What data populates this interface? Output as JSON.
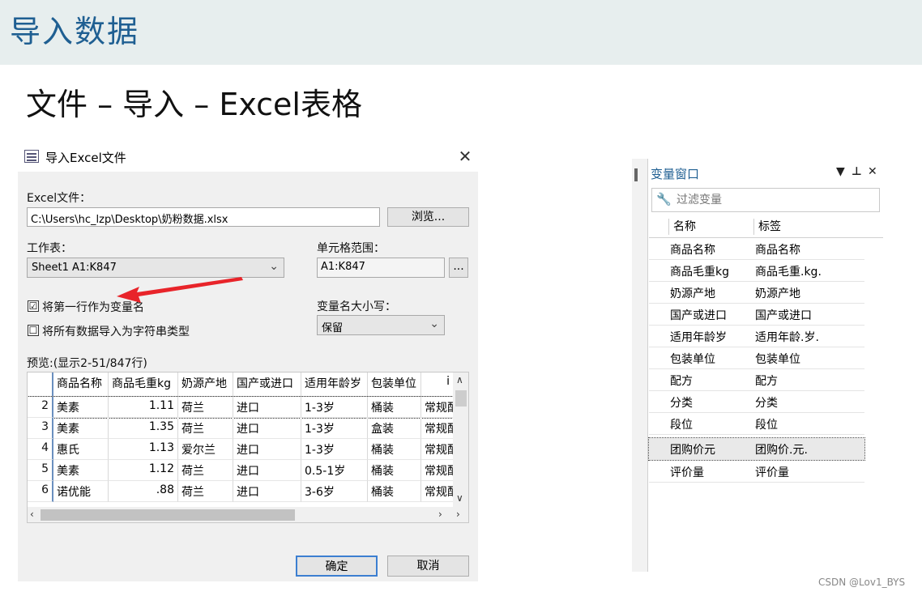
{
  "slide": {
    "title": "导入数据",
    "subtitle": "文件 – 导入 – Excel表格"
  },
  "dialog": {
    "title": "导入Excel文件",
    "file_label": "Excel文件：",
    "file_path": "C:\\Users\\hc_lzp\\Desktop\\奶粉数据.xlsx",
    "browse_button": "浏览...",
    "sheet_label": "工作表：",
    "sheet_value": "Sheet1 A1:K847",
    "range_label": "单元格范围：",
    "range_value": "A1:K847",
    "range_button": "...",
    "first_row_checkbox": {
      "label": "将第一行作为变量名",
      "checked": true,
      "mark": "☑"
    },
    "import_string_checkbox": {
      "label": "将所有数据导入为字符串类型",
      "checked": false,
      "mark": "☐"
    },
    "case_label": "变量名大小写：",
    "case_value": "保留",
    "preview_label": "预览:(显示2-51/847行)",
    "ok_button": "确定",
    "cancel_button": "取消",
    "close_glyph": "✕",
    "preview": {
      "columns": [
        "商品名称",
        "商品毛重kg",
        "奶源产地",
        "国产或进口",
        "适用年龄岁",
        "包装单位",
        "i"
      ],
      "rows": [
        {
          "n": "2",
          "cells": [
            "美素",
            "1.11",
            "荷兰",
            "进口",
            "1-3岁",
            "桶装",
            "常规配"
          ]
        },
        {
          "n": "3",
          "cells": [
            "美素",
            "1.35",
            "荷兰",
            "进口",
            "1-3岁",
            "盒装",
            "常规配"
          ]
        },
        {
          "n": "4",
          "cells": [
            "惠氏",
            "1.13",
            "爱尔兰",
            "进口",
            "1-3岁",
            "桶装",
            "常规配"
          ]
        },
        {
          "n": "5",
          "cells": [
            "美素",
            "1.12",
            "荷兰",
            "进口",
            "0.5-1岁",
            "桶装",
            "常规配"
          ]
        },
        {
          "n": "6",
          "cells": [
            "诺优能",
            ".88",
            "荷兰",
            "进口",
            "3-6岁",
            "桶装",
            "常规配"
          ]
        }
      ]
    }
  },
  "variable_window": {
    "title": "变量窗口",
    "controls": [
      "▼",
      "⊥",
      "✕"
    ],
    "filter_placeholder": "过滤变量",
    "filter_icon": "🔧",
    "col_name": "名称",
    "col_label": "标签",
    "rows": [
      {
        "name": "商品名称",
        "label": "商品名称"
      },
      {
        "name": "商品毛重kg",
        "label": "商品毛重.kg."
      },
      {
        "name": "奶源产地",
        "label": "奶源产地"
      },
      {
        "name": "国产或进口",
        "label": "国产或进口"
      },
      {
        "name": "适用年龄岁",
        "label": "适用年龄.岁."
      },
      {
        "name": "包装单位",
        "label": "包装单位"
      },
      {
        "name": "配方",
        "label": "配方"
      },
      {
        "name": "分类",
        "label": "分类"
      },
      {
        "name": "段位",
        "label": "段位"
      },
      {
        "name": "团购价元",
        "label": "团购价.元.",
        "selected": true
      },
      {
        "name": "评价量",
        "label": "评价量"
      }
    ]
  },
  "watermark": "CSDN @Lov1_BYS",
  "colors": {
    "title": "#1f5f92",
    "header_band": "#e7eeee",
    "annotation_arrow": "#e8242a"
  }
}
